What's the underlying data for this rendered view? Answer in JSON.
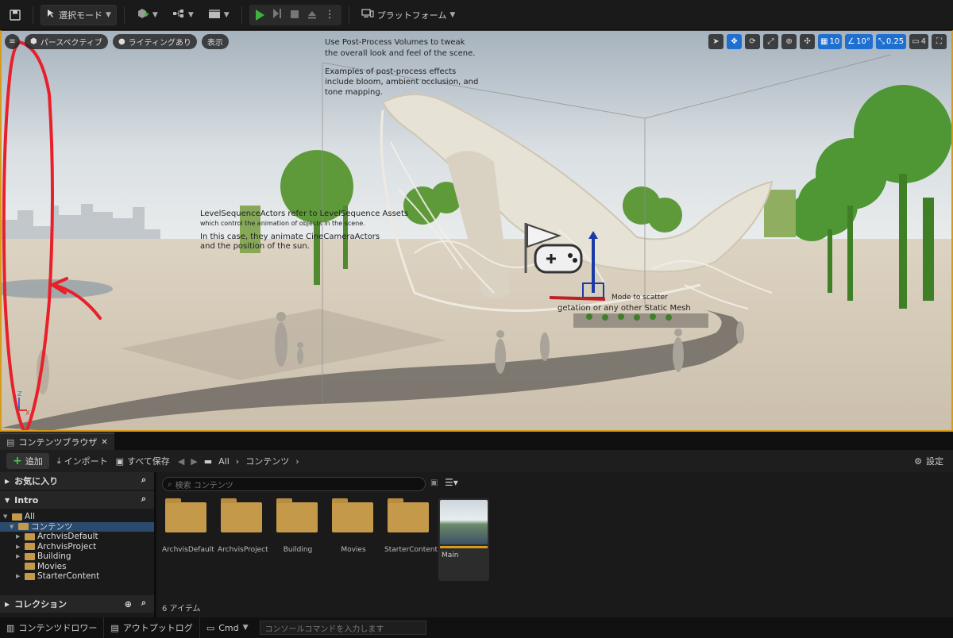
{
  "toolbar": {
    "mode_label": "選択モード",
    "platform_label": "プラットフォーム"
  },
  "viewport": {
    "perspective_label": "パースペクティブ",
    "lighting_label": "ライティングあり",
    "show_label": "表示",
    "grid_snap": "10",
    "rotate_snap": "10°",
    "scale_snap": "0.25",
    "camera_speed": "4",
    "overlay_texts": {
      "postprocess_1": "Use Post-Process Volumes to tweak",
      "postprocess_2": "the overall look and feel of the scene.",
      "postprocess_3": "Examples of post-process effects",
      "postprocess_4": "include bloom, ambient occlusion, and",
      "postprocess_5": "tone mapping.",
      "levelseq_1": "LevelSequenceActors refer to LevelSequence Assets",
      "levelseq_2": "which control the animation of objects in the scene.",
      "levelseq_3": "In this case, they animate CineCameraActors",
      "levelseq_4": "and the position of the sun.",
      "scatter_1": "Mode to scatter",
      "scatter_2": "getation or any other Static Mesh"
    }
  },
  "content_browser": {
    "tab_label": "コンテンツブラウザ",
    "add_label": "追加",
    "import_label": "インポート",
    "save_all_label": "すべて保存",
    "crumb_all": "All",
    "crumb_content": "コンテンツ",
    "settings_label": "設定",
    "favorites_label": "お気に入り",
    "project_label": "Intro",
    "collections_label": "コレクション",
    "tree": [
      {
        "label": "All",
        "depth": 0
      },
      {
        "label": "コンテンツ",
        "depth": 1
      },
      {
        "label": "ArchvisDefault",
        "depth": 2
      },
      {
        "label": "ArchvisProject",
        "depth": 2
      },
      {
        "label": "Building",
        "depth": 2
      },
      {
        "label": "Movies",
        "depth": 2
      },
      {
        "label": "StarterContent",
        "depth": 2
      }
    ],
    "search_placeholder": "検索 コンテンツ",
    "folders": [
      "ArchvisDefault",
      "ArchvisProject",
      "Building",
      "Movies",
      "StarterContent"
    ],
    "asset_label": "Main",
    "item_count": "6 アイテム"
  },
  "statusbar": {
    "content_drawer": "コンテンツドロワー",
    "output_log": "アウトプットログ",
    "cmd_label": "Cmd",
    "console_placeholder": "コンソールコマンドを入力します"
  },
  "colors": {
    "accent": "#d89a1a",
    "play_green": "#3fb23f",
    "selection_blue": "#1f6fd1",
    "annotation_red": "#e8202a"
  }
}
